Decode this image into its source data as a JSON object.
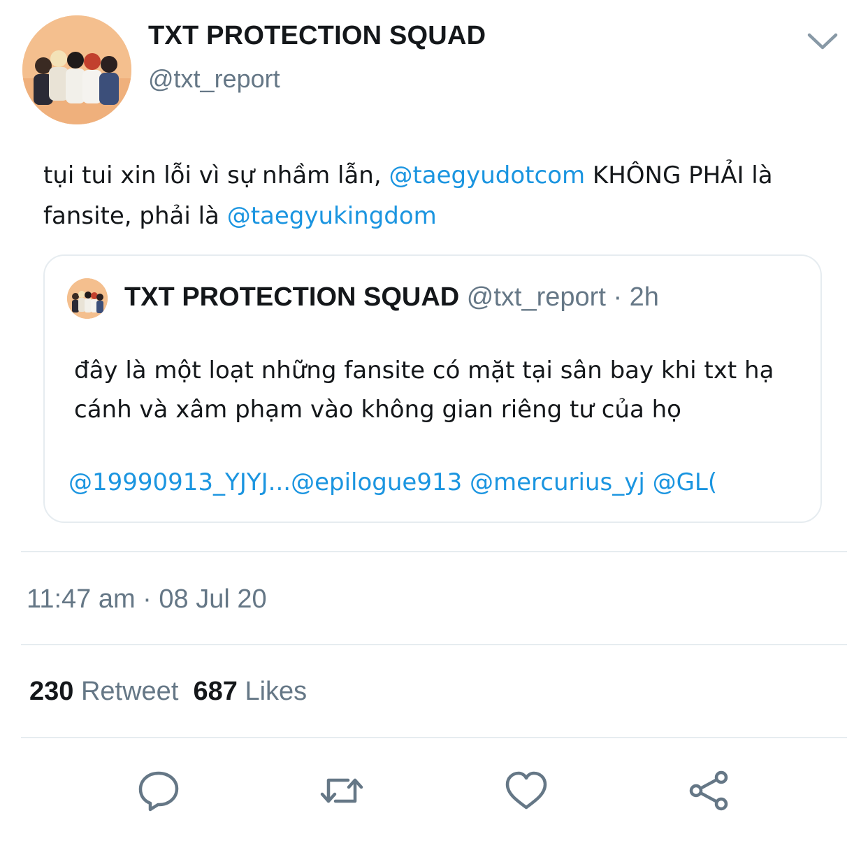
{
  "tweet": {
    "author": {
      "display_name": "TXT PROTECTION SQUAD",
      "handle": "@txt_report"
    },
    "text": {
      "part1": "tụi tui xin lỗi vì sự nhầm lẫn, ",
      "mention1": "@taegyudotcom",
      "part2": " KHÔNG PHẢI là fansite, phải là ",
      "mention2": "@taegyukingdom"
    },
    "quoted": {
      "display_name": "TXT PROTECTION SQUAD",
      "handle_time": " @txt_report · 2h",
      "text": "đây là một loạt những fansite có mặt tại sân bay khi txt hạ cánh và xâm phạm vào không gian riêng tư của họ",
      "mentions": "@19990913_YJYJ...@epilogue913 @mercurius_yj @GL("
    },
    "timestamp": "11:47 am · 08 Jul 20",
    "stats": {
      "retweets": "230",
      "retweet_label": "Retweet",
      "likes": "687",
      "likes_label": "Likes"
    }
  },
  "colors": {
    "link": "#1b95e0",
    "secondary_text": "#657786",
    "divider": "#e6ecf0"
  },
  "icons": {
    "menu": "chevron-down-icon",
    "reply": "reply-icon",
    "retweet": "retweet-icon",
    "like": "heart-icon",
    "share": "share-icon"
  }
}
